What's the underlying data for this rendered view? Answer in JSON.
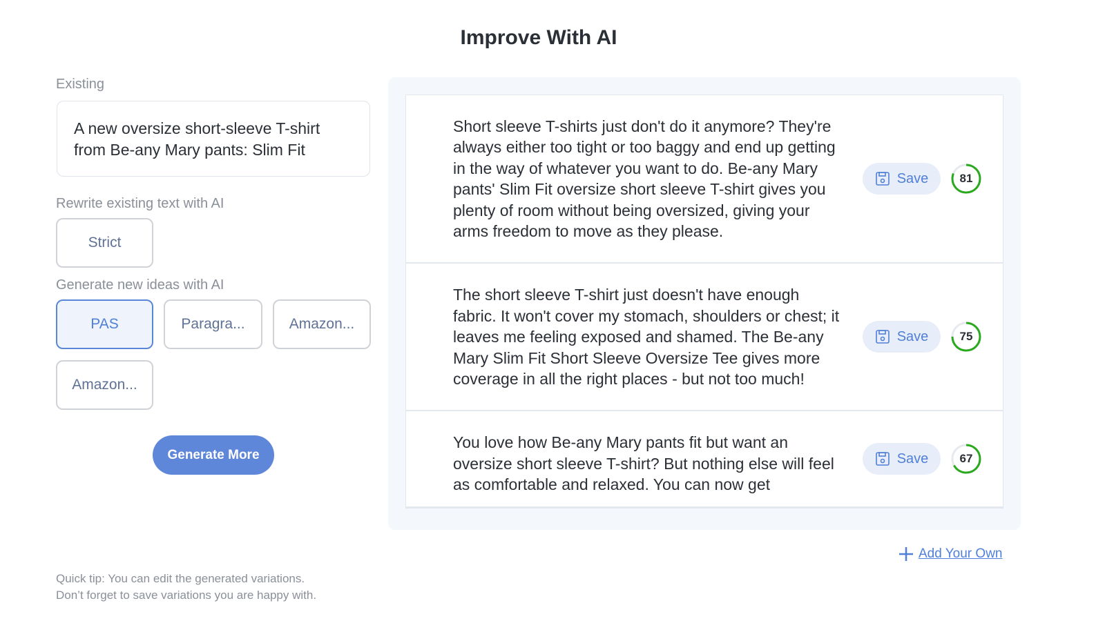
{
  "title": "Improve With AI",
  "existing": {
    "label": "Existing",
    "text": "A new oversize short-sleeve T-shirt from Be-any Mary pants: Slim Fit"
  },
  "rewrite": {
    "label": "Rewrite existing text with AI",
    "options": [
      "Strict"
    ]
  },
  "generate": {
    "label": "Generate new ideas with AI",
    "options": [
      "PAS",
      "Paragra...",
      "Amazon...",
      "Amazon..."
    ],
    "selected": "PAS"
  },
  "generate_more": "Generate More",
  "variations": [
    {
      "text": "Short sleeve T-shirts just don't do it anymore? They're always either too tight or too baggy and end up getting in the way of whatever you want to do. Be-any Mary pants' Slim Fit oversize short sleeve T-shirt gives you plenty of room without being oversized, giving your arms freedom to move as they please.",
      "save": "Save",
      "score": 81
    },
    {
      "text": "The short sleeve T-shirt just doesn't have enough fabric. It won't cover my stomach, shoulders or chest; it leaves me feeling exposed and shamed. The Be-any Mary Slim Fit Short Sleeve Oversize Tee gives more coverage in all the right places - but not too much!",
      "save": "Save",
      "score": 75
    },
    {
      "text": "You love how Be-any Mary pants fit but want an oversize short sleeve T-shirt? But nothing else will feel as comfortable and relaxed. You can now get",
      "save": "Save",
      "score": 67
    }
  ],
  "add_own": "Add Your Own",
  "tip": [
    "Quick tip: You can edit the generated variations.",
    "Don’t forget to save variations you are happy with."
  ],
  "colors": {
    "accent": "#5f87d9",
    "score": "#2aa81e",
    "panel": "#f4f7fc"
  }
}
